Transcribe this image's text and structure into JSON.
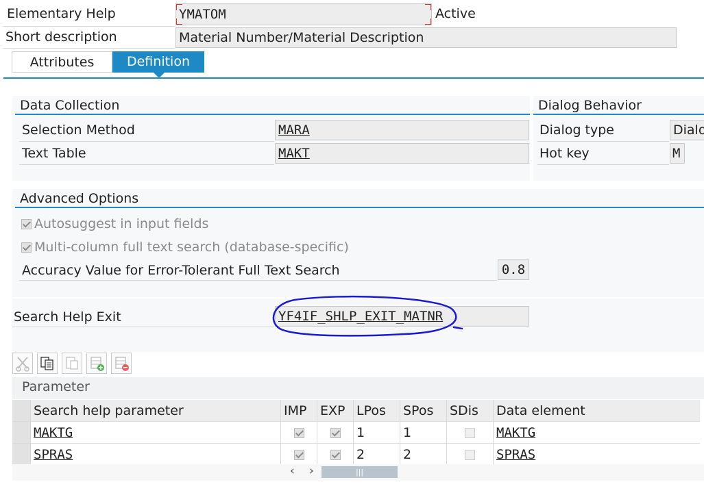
{
  "header": {
    "elementary_label": "Elementary Help",
    "name_value": "YMATOM",
    "status": "Active",
    "short_desc_label": "Short description",
    "short_desc_value": "Material Number/Material Description"
  },
  "tabs": [
    {
      "label": "Attributes"
    },
    {
      "label": "Definition"
    }
  ],
  "data_collection": {
    "title": "Data Collection",
    "selection_method_label": "Selection Method",
    "selection_method_value": "MARA",
    "text_table_label": "Text Table",
    "text_table_value": "MAKT"
  },
  "dialog_behavior": {
    "title": "Dialog Behavior",
    "dialog_type_label": "Dialog type",
    "dialog_type_value": "Dialo",
    "hot_key_label": "Hot key",
    "hot_key_value": "M"
  },
  "advanced": {
    "title": "Advanced Options",
    "autosuggest_label": "Autosuggest in input fields",
    "autosuggest_checked": true,
    "multicolumn_label": "Multi-column full text search (database-specific)",
    "multicolumn_checked": true,
    "accuracy_label": "Accuracy Value for Error-Tolerant Full Text Search",
    "accuracy_value": "0.8"
  },
  "exit": {
    "label": "Search Help Exit",
    "value": "YF4IF_SHLP_EXIT_MATNR"
  },
  "toolbar": {
    "icons": [
      "cut-icon",
      "copy-icon",
      "paste-icon",
      "insert-row-icon",
      "delete-row-icon"
    ]
  },
  "parameter_table": {
    "title": "Parameter",
    "columns": [
      "Search help parameter",
      "IMP",
      "EXP",
      "LPos",
      "SPos",
      "SDis",
      "Data element"
    ],
    "rows": [
      {
        "param": "MAKTG",
        "imp": true,
        "exp": true,
        "lpos": "1",
        "spos": "1",
        "sdis": false,
        "data_element": "MAKTG"
      },
      {
        "param": "SPRAS",
        "imp": true,
        "exp": true,
        "lpos": "2",
        "spos": "2",
        "sdis": false,
        "data_element": "SPRAS"
      }
    ]
  },
  "scroll": {
    "left": "‹",
    "right": "›",
    "thumb": "|||"
  },
  "colors": {
    "accent": "#1d8ac6",
    "annotation": "#1a1ad1",
    "required_marker": "#e0312b"
  }
}
